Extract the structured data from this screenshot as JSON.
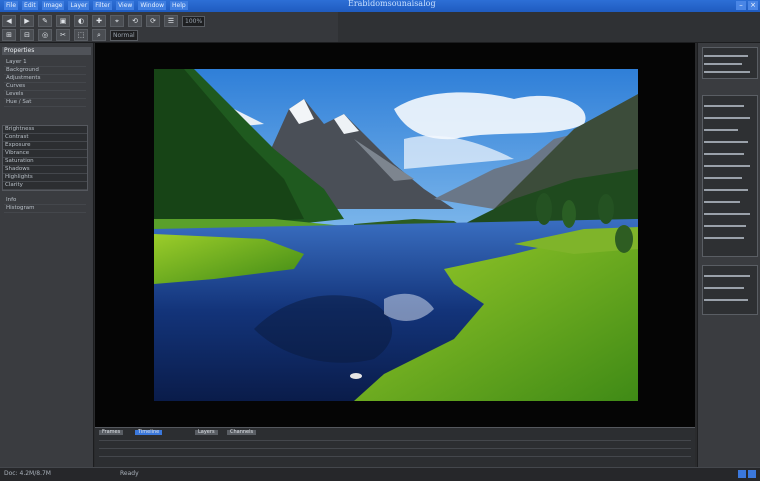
{
  "window": {
    "title": "Erabidomsounaisalog",
    "close_glyph": "×"
  },
  "menu": [
    "File",
    "Edit",
    "Image",
    "Layer",
    "Filter",
    "View",
    "Window",
    "Help"
  ],
  "toolbar": {
    "row1": [
      "◀",
      "▶",
      "✎",
      "▣",
      "◐",
      "✚",
      "⌖",
      "⟲",
      "⟳",
      "☰"
    ],
    "row2": [
      "⊞",
      "⊟",
      "◎",
      "✂",
      "⬚",
      "⌕"
    ],
    "field1": "100%",
    "field2": "Normal"
  },
  "left_panel": {
    "header": "Properties",
    "items_top": [
      "Layer 1",
      "Background",
      "Adjustments",
      "Curves",
      "Levels",
      "Hue / Sat"
    ],
    "items_box": [
      "Brightness",
      "Contrast",
      "Exposure",
      "Vibrance",
      "Saturation",
      "Shadows",
      "Highlights",
      "Clarity"
    ],
    "items_bottom": [
      "Info",
      "Histogram"
    ]
  },
  "timeline": {
    "tabs": [
      "Frames",
      "Timeline",
      "Layers",
      "Channels"
    ]
  },
  "status": {
    "left": "Doc: 4.2M/8.7M",
    "mid": "Ready"
  },
  "colors": {
    "accent": "#2d6fd6",
    "panel": "#3a3c40",
    "canvas": "#050505"
  }
}
